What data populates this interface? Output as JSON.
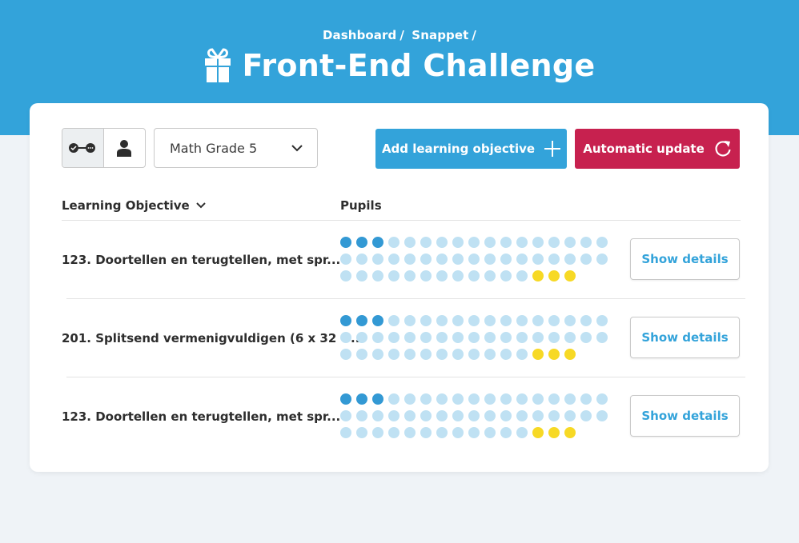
{
  "header": {
    "breadcrumb": [
      "Dashboard",
      "/",
      "Snappet",
      "/"
    ],
    "title": "Front-End Challenge",
    "icon": "gift-icon"
  },
  "toolbar": {
    "view_toggle": [
      {
        "icon": "objectives-icon",
        "active": true
      },
      {
        "icon": "person-icon",
        "active": false
      }
    ],
    "select_value": "Math Grade 5",
    "add_label": "Add learning objective",
    "auto_label": "Automatic update"
  },
  "table": {
    "col_objective": "Learning Objective",
    "col_pupils": "Pupils",
    "details_label": "Show details",
    "rows": [
      {
        "objective": "123. Doortellen en terugtellen, met spr...",
        "pupils": {
          "strong": 3,
          "weak": 43,
          "attention": 3
        }
      },
      {
        "objective": "201. Splitsend vermenigvuldigen (6 x 32 =...",
        "pupils": {
          "strong": 3,
          "weak": 43,
          "attention": 3
        }
      },
      {
        "objective": "123. Doortellen en terugtellen, met spr...",
        "pupils": {
          "strong": 3,
          "weak": 43,
          "attention": 3
        }
      }
    ]
  },
  "colors": {
    "primary": "#33a3da",
    "danger": "#c7214f",
    "dot_strong": "#3399d4",
    "dot_weak": "#bfe1f3",
    "dot_attention": "#f7d925"
  }
}
